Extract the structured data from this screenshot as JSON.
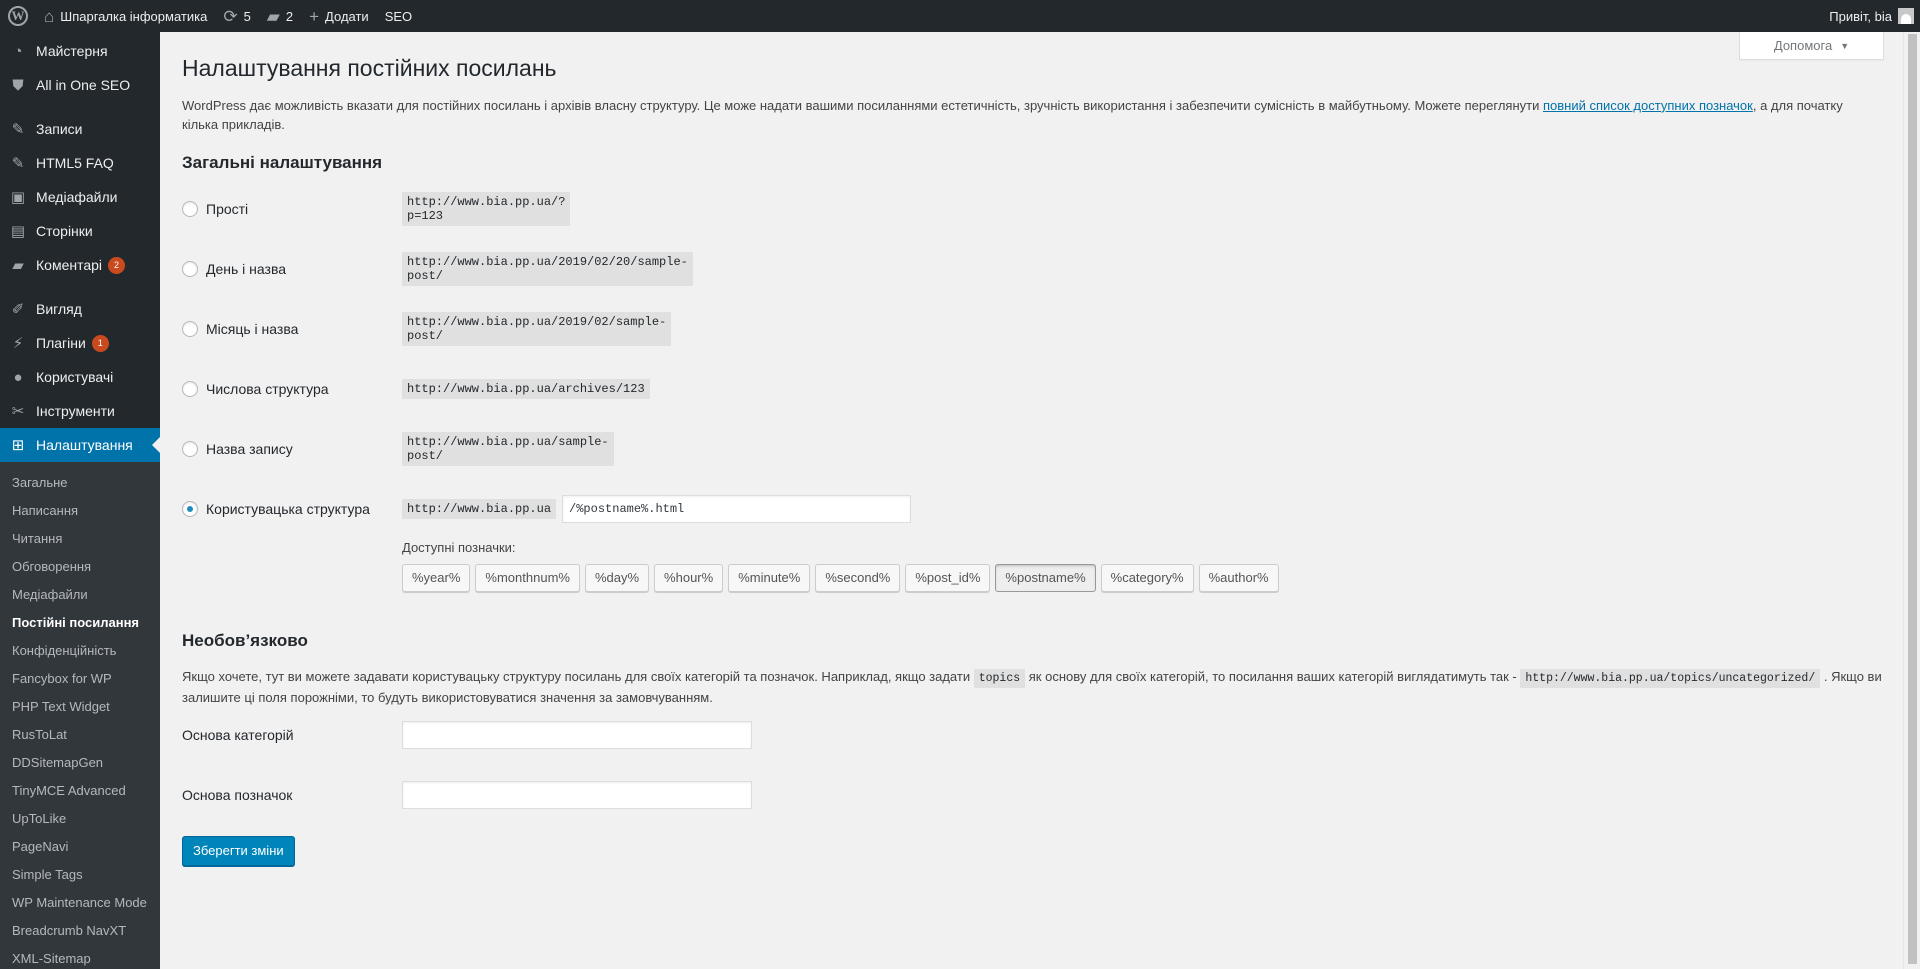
{
  "adminbar": {
    "site_name": "Шпаргалка інформатика",
    "updates_count": "5",
    "comments_count": "2",
    "new_label": "Додати",
    "seo_label": "SEO",
    "greeting": "Привіт, bia"
  },
  "sidebar": {
    "items": [
      {
        "label": "Майстерня",
        "icon": "dashboard-icon"
      },
      {
        "label": "All in One SEO",
        "icon": "shield-icon"
      },
      {
        "label": "Записи",
        "icon": "pin-icon"
      },
      {
        "label": "HTML5 FAQ",
        "icon": "pin-icon"
      },
      {
        "label": "Медіафайли",
        "icon": "media-icon"
      },
      {
        "label": "Сторінки",
        "icon": "page-icon"
      },
      {
        "label": "Коментарі",
        "icon": "comment-icon",
        "badge": "2"
      },
      {
        "label": "Вигляд",
        "icon": "brush-icon"
      },
      {
        "label": "Плагіни",
        "icon": "plugin-icon",
        "badge": "1"
      },
      {
        "label": "Користувачі",
        "icon": "user-icon"
      },
      {
        "label": "Інструменти",
        "icon": "wrench-icon"
      },
      {
        "label": "Налаштування",
        "icon": "settings-icon"
      }
    ],
    "submenu": [
      "Загальне",
      "Написання",
      "Читання",
      "Обговорення",
      "Медіафайли",
      "Постійні посилання",
      "Конфіденційність",
      "Fancybox for WP",
      "PHP Text Widget",
      "RusToLat",
      "DDSitemapGen",
      "TinyMCE Advanced",
      "UpToLike",
      "PageNavi",
      "Simple Tags",
      "WP Maintenance Mode",
      "Breadcrumb NavXT",
      "XML-Sitemap"
    ]
  },
  "help_tab": "Допомога",
  "page": {
    "title": "Налаштування постійних посилань",
    "intro_before_link": "WordPress дає можливість вказати для постійних посилань і архівів власну структуру. Це може надати вашими посиланнями естетичність, зручність використання і забезпечити сумісність в майбутньому. Можете переглянути ",
    "intro_link": "повний список доступних позначок",
    "intro_after_link": ", а для початку кілька прикладів.",
    "general_heading": "Загальні налаштування",
    "options": [
      {
        "label": "Прості",
        "example": "http://www.bia.pp.ua/?p=123",
        "checked": false
      },
      {
        "label": "День і назва",
        "example": "http://www.bia.pp.ua/2019/02/20/sample-post/",
        "checked": false
      },
      {
        "label": "Місяць і назва",
        "example": "http://www.bia.pp.ua/2019/02/sample-post/",
        "checked": false
      },
      {
        "label": "Числова структура",
        "example": "http://www.bia.pp.ua/archives/123",
        "checked": false
      },
      {
        "label": "Назва запису",
        "example": "http://www.bia.pp.ua/sample-post/",
        "checked": false
      },
      {
        "label": "Користувацька структура",
        "example": "http://www.bia.pp.ua",
        "checked": true
      }
    ],
    "custom_structure_value": "/%postname%.html",
    "available_tags_label": "Доступні позначки:",
    "tags": [
      "%year%",
      "%monthnum%",
      "%day%",
      "%hour%",
      "%minute%",
      "%second%",
      "%post_id%",
      "%postname%",
      "%category%",
      "%author%"
    ],
    "active_tag": "%postname%",
    "optional_heading": "Необов’язково",
    "optional_desc_1": "Якщо хочете, тут ви можете задавати користувацьку структуру посилань для своїх категорій та позначок. Наприклад, якщо задати ",
    "optional_code_1": "topics",
    "optional_desc_2": " як основу для своїх категорій, то посилання ваших категорій виглядатимуть так - ",
    "optional_code_2": "http://www.bia.pp.ua/topics/uncategorized/",
    "optional_desc_3": " . Якщо ви залишите ці поля порожніми, то будуть використовуватися значення за замовчуванням.",
    "category_base_label": "Основа категорій",
    "category_base_value": "",
    "tag_base_label": "Основа позначок",
    "tag_base_value": "",
    "save_label": "Зберегти зміни"
  },
  "colors": {
    "accent": "#0073aa",
    "admin_bar": "#23282d",
    "button": "#0085ba",
    "badge": "#ca4a1f"
  }
}
